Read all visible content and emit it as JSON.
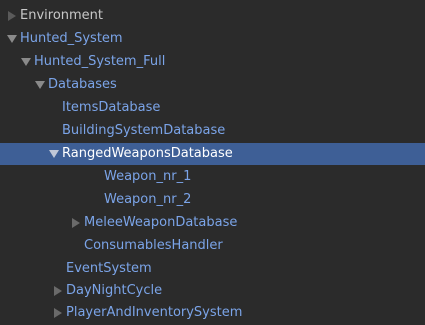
{
  "hierarchy": {
    "items": [
      {
        "label": "Environment",
        "expander": "collapsed",
        "kind": "scene"
      },
      {
        "label": "Hunted_System",
        "expander": "expanded",
        "kind": "object"
      },
      {
        "label": "Hunted_System_Full",
        "expander": "expanded",
        "kind": "object"
      },
      {
        "label": "Databases",
        "expander": "expanded",
        "kind": "object"
      },
      {
        "label": "ItemsDatabase",
        "expander": "none",
        "kind": "object"
      },
      {
        "label": "BuildingSystemDatabase",
        "expander": "none",
        "kind": "object"
      },
      {
        "label": "RangedWeaponsDatabase",
        "expander": "expanded",
        "kind": "object",
        "selected": true
      },
      {
        "label": "Weapon_nr_1",
        "expander": "none",
        "kind": "object"
      },
      {
        "label": "Weapon_nr_2",
        "expander": "none",
        "kind": "object"
      },
      {
        "label": "MeleeWeaponDatabase",
        "expander": "collapsed",
        "kind": "object"
      },
      {
        "label": "ConsumablesHandler",
        "expander": "none",
        "kind": "object"
      },
      {
        "label": "EventSystem",
        "expander": "none",
        "kind": "object"
      },
      {
        "label": "DayNightCycle",
        "expander": "collapsed",
        "kind": "object"
      },
      {
        "label": "PlayerAndInventorySystem",
        "expander": "collapsed",
        "kind": "object"
      }
    ]
  },
  "colors": {
    "background": "#2b2b2b",
    "selection": "#3e5f96",
    "object_text": "#7ba4e8",
    "scene_text": "#c8c8c8",
    "arrow": "#8a8a8a"
  }
}
